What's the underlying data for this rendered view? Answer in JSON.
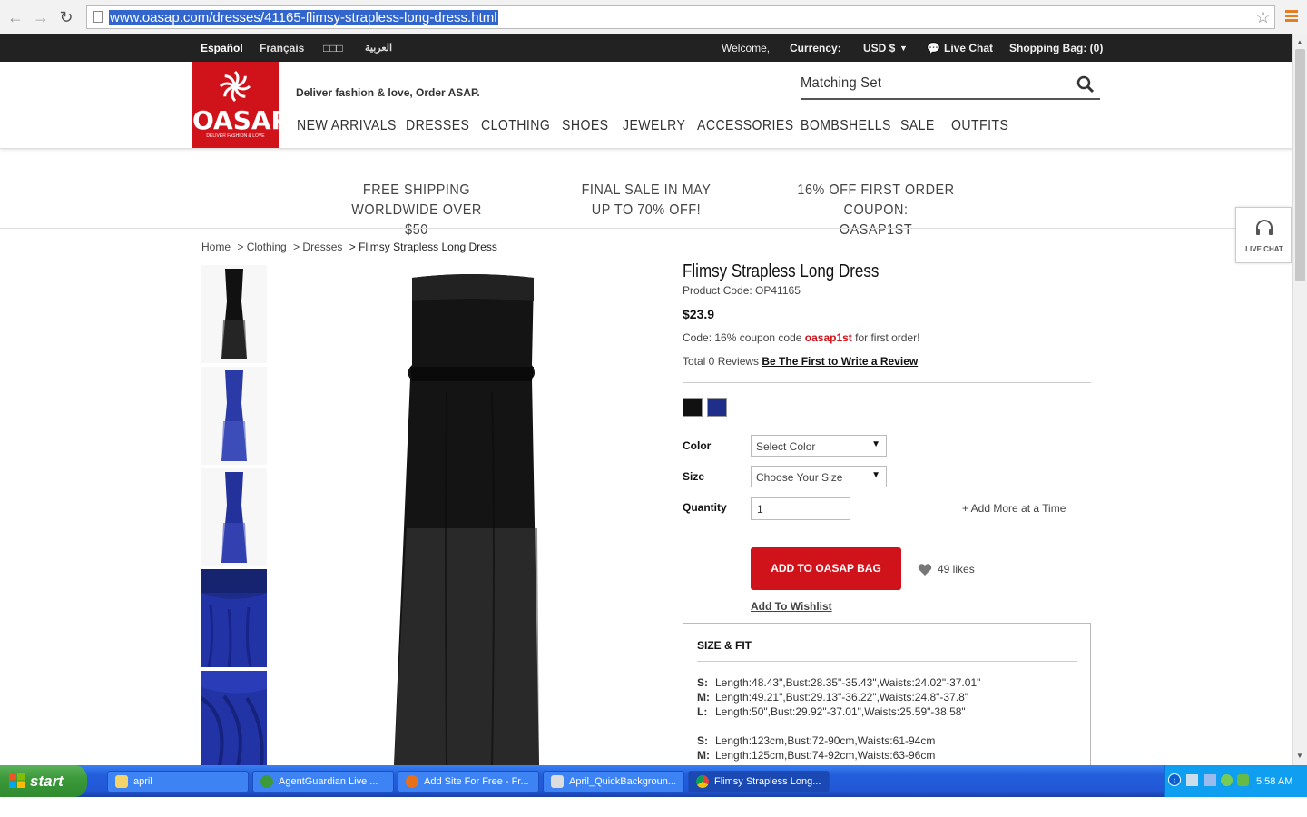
{
  "browser": {
    "url": "www.oasap.com/dresses/41165-flimsy-strapless-long-dress.html"
  },
  "topbar": {
    "languages": [
      "Español",
      "Français",
      "□□□",
      "العربية"
    ],
    "welcome": "Welcome,",
    "currency_label": "Currency:",
    "currency_value": "USD $",
    "live_chat": "Live Chat",
    "shopping_bag": "Shopping Bag: (0)"
  },
  "header": {
    "logo_text": "OASAP",
    "logo_sub": "DELIVER FASHION & LOVE",
    "tagline": "Deliver fashion & love, Order ASAP.",
    "search_value": "Matching Set",
    "nav": [
      "NEW ARRIVALS",
      "DRESSES",
      "CLOTHING",
      "SHOES",
      "JEWELRY",
      "ACCESSORIES",
      "BOMBSHELLS",
      "SALE",
      "OUTFITS"
    ]
  },
  "promos": [
    {
      "line1": "FREE SHIPPING",
      "line2": "WORLDWIDE OVER $50"
    },
    {
      "line1": "FINAL SALE IN MAY",
      "line2": "UP TO 70% OFF!"
    },
    {
      "line1": "16% OFF FIRST ORDER COUPON:",
      "line2": "OASAP1ST"
    }
  ],
  "side_chat": {
    "label": "LIVE CHAT"
  },
  "breadcrumb": [
    "Home",
    "> Clothing",
    "> Dresses",
    "> Flimsy Strapless Long Dress"
  ],
  "product": {
    "title": "Flimsy Strapless Long Dress",
    "code": "Product Code: OP41165",
    "price": "$23.9",
    "coupon_prefix": "Code: 16% coupon code ",
    "coupon_code": "oasap1st",
    "coupon_suffix": " for first order!",
    "reviews_prefix": "Total 0 Reviews ",
    "reviews_link": "Be The First to Write a Review",
    "swatch_colors": [
      "#111111",
      "#1f2e8a"
    ],
    "color_label": "Color",
    "color_select": "Select Color",
    "size_label": "Size",
    "size_select": "Choose Your Size",
    "quantity_label": "Quantity",
    "quantity_value": "1",
    "add_more": "+ Add More at a Time",
    "add_to_bag": "ADD TO OASAP BAG",
    "likes": "49  likes",
    "wishlist": "Add To Wishlist"
  },
  "size_fit": {
    "title": "SIZE & FIT",
    "inches": [
      {
        "size": "S:",
        "text": "Length:48.43\",Bust:28.35\"-35.43\",Waists:24.02\"-37.01\""
      },
      {
        "size": "M:",
        "text": "Length:49.21\",Bust:29.13\"-36.22\",Waists:24.8\"-37.8\""
      },
      {
        "size": "L:",
        "text": "Length:50\",Bust:29.92\"-37.01\",Waists:25.59\"-38.58\""
      }
    ],
    "cm": [
      {
        "size": "S:",
        "text": "Length:123cm,Bust:72-90cm,Waists:61-94cm"
      },
      {
        "size": "M:",
        "text": "Length:125cm,Bust:74-92cm,Waists:63-96cm"
      }
    ]
  },
  "taskbar": {
    "start": "start",
    "tasks": [
      "april",
      "AgentGuardian Live ...",
      "Add Site For Free - Fr...",
      "April_QuickBackgroun...",
      "Flimsy Strapless Long..."
    ],
    "clock": "5:58 AM"
  },
  "colors": {
    "brand_red": "#d0121a",
    "topbar": "#222222",
    "taskbar_blue": "#245edb"
  }
}
